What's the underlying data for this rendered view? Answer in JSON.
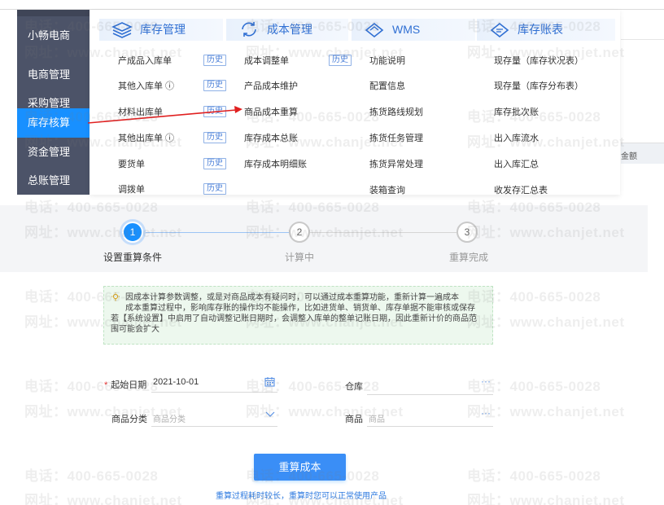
{
  "sidebar": {
    "items": [
      {
        "label": "小畅电商",
        "active": false
      },
      {
        "label": "电商管理",
        "active": false
      },
      {
        "label": "采购管理",
        "active": false
      },
      {
        "label": "库存核算",
        "active": true
      },
      {
        "label": "资金管理",
        "active": false
      },
      {
        "label": "总账管理",
        "active": false
      }
    ]
  },
  "mega_menu": {
    "history_label": "历史",
    "columns": [
      {
        "title": "库存管理",
        "icon": "stack-icon",
        "items": [
          {
            "label": "产成品入库单",
            "history": true
          },
          {
            "label": "其他入库单 ⓘ",
            "history": true
          },
          {
            "label": "材料出库单",
            "history": true
          },
          {
            "label": "其他出库单 ⓘ",
            "history": true
          },
          {
            "label": "要货单",
            "history": true
          },
          {
            "label": "调拨单",
            "history": true
          }
        ]
      },
      {
        "title": "成本管理",
        "icon": "cycle-icon",
        "items": [
          {
            "label": "成本调整单",
            "history": true
          },
          {
            "label": "产品成本维护",
            "history": false
          },
          {
            "label": "商品成本重算",
            "history": false
          },
          {
            "label": "库存成本总账",
            "history": false
          },
          {
            "label": "库存成本明细账",
            "history": false
          }
        ]
      },
      {
        "title": "WMS",
        "icon": "box-icon",
        "items": [
          {
            "label": "功能说明"
          },
          {
            "label": "配置信息"
          },
          {
            "label": "拣货路线规划"
          },
          {
            "label": "拣货任务管理"
          },
          {
            "label": "拣货异常处理"
          },
          {
            "label": "装箱查询"
          }
        ]
      },
      {
        "title": "库存账表",
        "icon": "ledger-icon",
        "items": [
          {
            "label": "现存量（库存状况表）"
          },
          {
            "label": "现存量（库存分布表）"
          },
          {
            "label": "库存批次账"
          },
          {
            "label": "出入库流水"
          },
          {
            "label": "出入库汇总"
          },
          {
            "label": "收发存汇总表"
          }
        ]
      }
    ]
  },
  "background": {
    "column_header": "金额"
  },
  "stepper": {
    "steps": [
      {
        "number": "1",
        "label": "设置重算条件",
        "state": "active"
      },
      {
        "number": "2",
        "label": "计算中",
        "state": "pending"
      },
      {
        "number": "3",
        "label": "重算完成",
        "state": "pending"
      }
    ]
  },
  "notice": {
    "line1": "因成本计算参数调整，或是对商品成本有疑问时，可以通过成本重算功能，重新计算一遍成本",
    "line2": "成本重算过程中，影响库存账的操作均不能操作，比如进货单、销货单、库存单据不能审核或保存",
    "line3": "若【系统设置】中启用了自动调整记账日期时，会调整入库单的整单记账日期，因此重新计价的商品范",
    "line4": "围可能会扩大"
  },
  "form": {
    "start_date_label": "起始日期",
    "start_date_value": "2021-10-01",
    "warehouse_label": "仓库",
    "category_label": "商品分类",
    "category_placeholder": "商品分类",
    "product_label": "商品",
    "product_placeholder": "商品",
    "ellipsis": "···"
  },
  "actions": {
    "recalc_label": "重算成本",
    "hint": "重算过程耗时较长，重算时您可以正常使用产品"
  },
  "watermark": {
    "phone": "电话：400-665-0028",
    "url": "网址：www.chanjet.net"
  },
  "colors": {
    "sidebar_bg": "#4c5368",
    "active_blue": "#1890ff",
    "button_blue": "#3a8ef6",
    "notice_bg": "#edf8ee",
    "arrow_red": "#e02020"
  }
}
